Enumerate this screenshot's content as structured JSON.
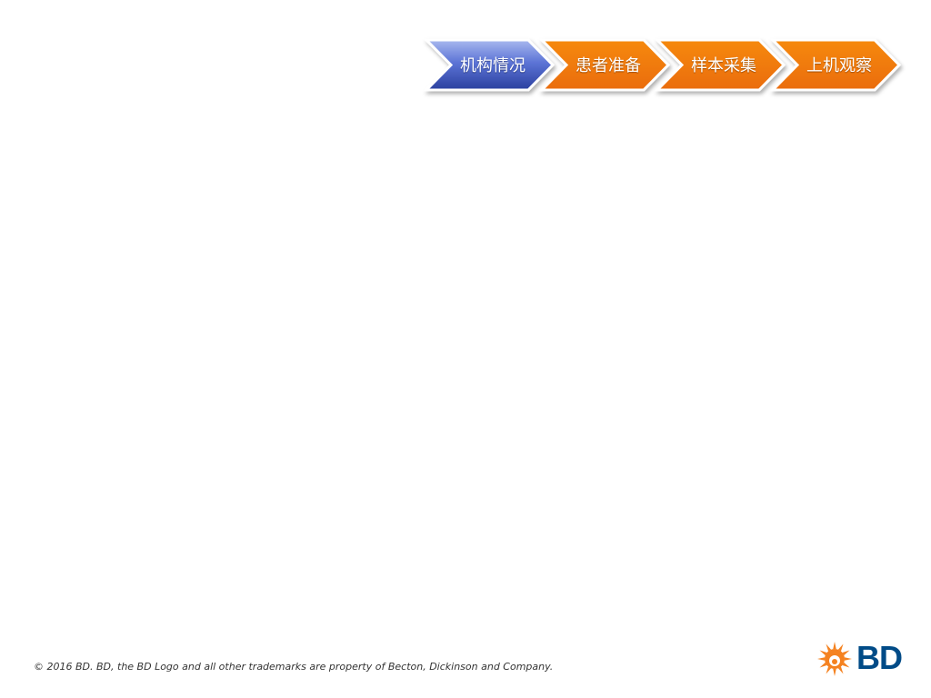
{
  "process_steps": [
    {
      "label": "机构情况",
      "state": "active",
      "color": "#3f58c2"
    },
    {
      "label": "患者准备",
      "state": "inactive",
      "color": "#f07a10"
    },
    {
      "label": "样本采集",
      "state": "inactive",
      "color": "#f07a10"
    },
    {
      "label": "上机观察",
      "state": "inactive",
      "color": "#f07a10"
    }
  ],
  "footer": {
    "copyright": "© 2016 BD. BD, the BD Logo and all other trademarks are property of Becton, Dickinson and Company."
  },
  "logo": {
    "text": "BD",
    "icon": "bd-sunburst-icon",
    "accent_color": "#f58220",
    "text_color": "#004b87"
  }
}
